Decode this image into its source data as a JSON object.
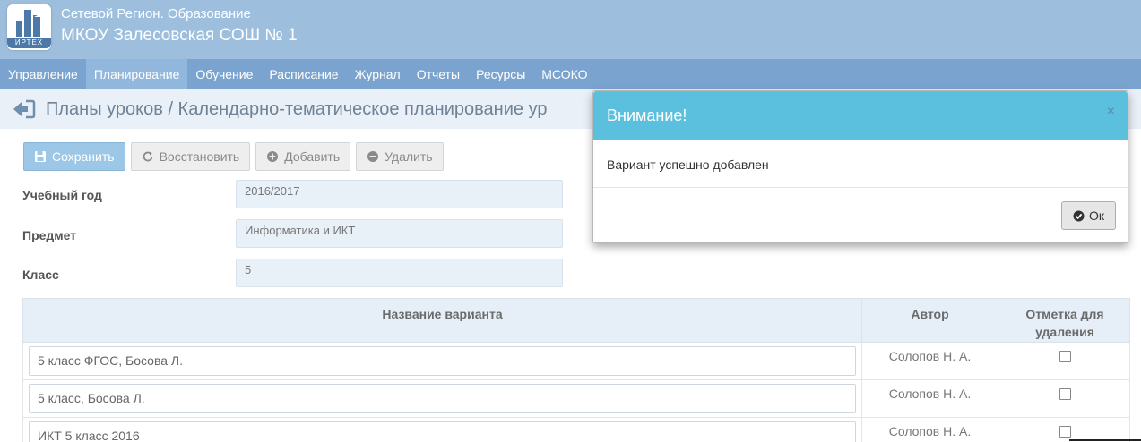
{
  "header": {
    "logo_text": "ИРТЕХ",
    "app_name": "Сетевой Регион. Образование",
    "school_name": "МКОУ Залесовская СОШ № 1"
  },
  "nav": {
    "items": [
      {
        "label": "Управление",
        "active": false
      },
      {
        "label": "Планирование",
        "active": true
      },
      {
        "label": "Обучение",
        "active": false
      },
      {
        "label": "Расписание",
        "active": false
      },
      {
        "label": "Журнал",
        "active": false
      },
      {
        "label": "Отчеты",
        "active": false
      },
      {
        "label": "Ресурсы",
        "active": false
      },
      {
        "label": "МСОКО",
        "active": false
      }
    ]
  },
  "breadcrumb": {
    "text": "Планы уроков / Календарно-тематическое планирование ур"
  },
  "toolbar": {
    "save_label": "Сохранить",
    "restore_label": "Восстановить",
    "add_label": "Добавить",
    "delete_label": "Удалить"
  },
  "form": {
    "year_label": "Учебный год",
    "year_value": "2016/2017",
    "subject_label": "Предмет",
    "subject_value": "Информатика и ИКТ",
    "class_label": "Класс",
    "class_value": "5"
  },
  "table": {
    "col_name": "Название варианта",
    "col_author": "Автор",
    "col_mark": "Отметка для удаления",
    "rows": [
      {
        "name": "5 класс ФГОС, Босова Л.",
        "author": "Солопов Н. А.",
        "checked": false
      },
      {
        "name": "5 класс, Босова Л.",
        "author": "Солопов Н. А.",
        "checked": false
      },
      {
        "name": "ИКТ 5 класс 2016",
        "author": "Солопов Н. А.",
        "checked": false
      }
    ]
  },
  "modal": {
    "title": "Внимание!",
    "close_glyph": "×",
    "message": "Вариант успешно добавлен",
    "ok_label": "Ок"
  },
  "colors": {
    "header_bg": "#9dbfdd",
    "nav_bg": "#7aa4cf",
    "modal_header": "#5bc0de"
  }
}
